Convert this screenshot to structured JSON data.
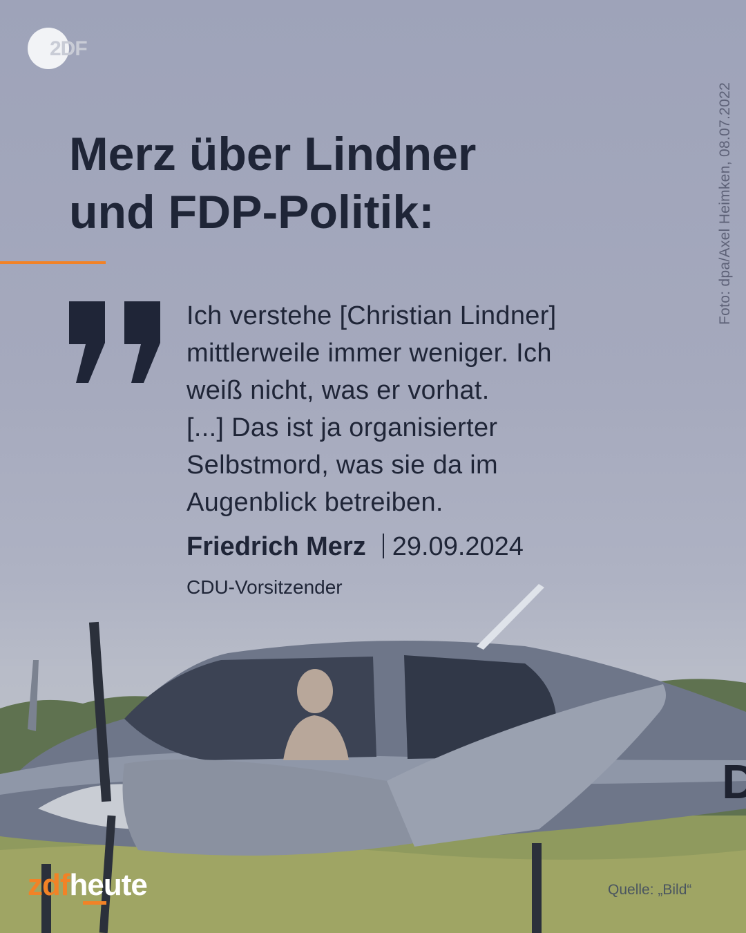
{
  "logo": {
    "icon": "zdf-logo-icon",
    "text": "2DF"
  },
  "photo_credit": "Foto: dpa/Axel Heimken, 08.07.2022",
  "headline": {
    "line1": "Merz über Lindner",
    "line2": "und FDP-Politik:"
  },
  "quote": {
    "icon": "quotation-mark-icon",
    "lines": [
      "Ich verstehe [Christian Lindner]",
      "mittlerweile immer weniger. Ich",
      "weiß nicht, was er vorhat.",
      "[...] Das ist ja organisierter",
      "Selbstmord, was sie da im",
      "Augenblick betreiben."
    ]
  },
  "attribution": {
    "name": "Friedrich Merz",
    "date": "29.09.2024",
    "role": "CDU-Vorsitzender"
  },
  "plane": {
    "registration": "D"
  },
  "brand": {
    "zdf": "zdf",
    "heute": "heute"
  },
  "source": "Quelle: „Bild“",
  "colors": {
    "accent": "#f28226",
    "text": "#1f2537",
    "sky": "#a5a9bd"
  }
}
